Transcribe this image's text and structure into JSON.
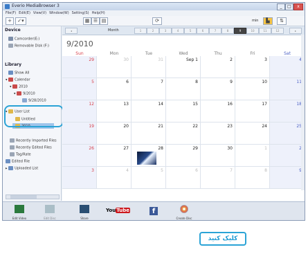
{
  "window": {
    "title": "Everio MediaBrowser 3",
    "min": "_",
    "max": "□",
    "close": "x"
  },
  "menu": [
    "File(F)",
    "Edit(E)",
    "View(V)",
    "Window(W)",
    "Setting(S)",
    "Help(H)"
  ],
  "toolbar": {
    "add": "+",
    "edit": "✓▾",
    "zoom_level": "min"
  },
  "sidebar": {
    "device_heading": "Device",
    "devices": [
      "Camcorder(E:)",
      "Removable Disk (F:)"
    ],
    "library_heading": "Library",
    "show_all": "Show All",
    "calendar": "Calendar",
    "year": "2010",
    "month": "9/2010",
    "day": "9/28/2010",
    "user_list": "User List",
    "user_items": [
      "Untitled",
      "2010"
    ],
    "recent": [
      "Recently Imported Files",
      "Recently Edited Files"
    ],
    "tag_rate": "Tag/Rate",
    "edited_file": "Edited File",
    "uploaded_list": "Uploaded List"
  },
  "month_nav": {
    "label": "Month",
    "months": [
      "1",
      "2",
      "3",
      "4",
      "5",
      "6",
      "7",
      "8",
      "9",
      "10",
      "11",
      "12"
    ],
    "current": "9"
  },
  "calendar": {
    "title": "9/2010",
    "weekdays": [
      "Sun",
      "Mon",
      "Tue",
      "Wed",
      "Thu",
      "Fri",
      "Sat"
    ],
    "weeks": [
      [
        "29",
        "30",
        "31",
        "Sep 1",
        "2",
        "3",
        "4"
      ],
      [
        "5",
        "6",
        "7",
        "8",
        "9",
        "10",
        "11"
      ],
      [
        "12",
        "13",
        "14",
        "15",
        "16",
        "17",
        "18"
      ],
      [
        "19",
        "20",
        "21",
        "22",
        "23",
        "24",
        "25"
      ],
      [
        "26",
        "27",
        "28",
        "29",
        "30",
        "1",
        "2"
      ],
      [
        "3",
        "4",
        "5",
        "6",
        "7",
        "8",
        "9"
      ]
    ],
    "current_week_flags": [
      [
        0,
        0,
        0,
        1,
        1,
        1,
        1
      ],
      [
        1,
        1,
        1,
        1,
        1,
        1,
        1
      ],
      [
        1,
        1,
        1,
        1,
        1,
        1,
        1
      ],
      [
        1,
        1,
        1,
        1,
        1,
        1,
        1
      ],
      [
        1,
        1,
        1,
        1,
        1,
        0,
        0
      ],
      [
        0,
        0,
        0,
        0,
        0,
        0,
        0
      ]
    ],
    "thumbnail_on": "28"
  },
  "bottom": {
    "buttons": [
      "Edit Video",
      "Edit Disc",
      "Share",
      "YouTube",
      "Facebook",
      "Create Disc"
    ]
  },
  "callout": {
    "text": "کلیک کنید",
    "color": "#1e9bd4"
  }
}
